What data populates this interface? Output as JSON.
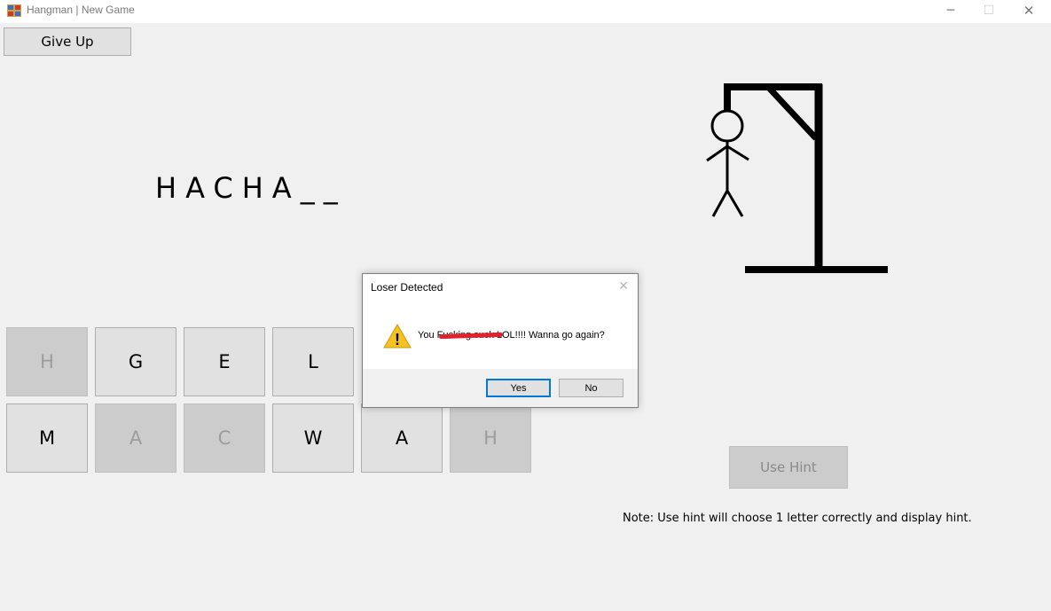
{
  "window": {
    "title": "Hangman | New Game",
    "minimize": "─",
    "maximize": "☐",
    "close": "✕"
  },
  "toolbar": {
    "give_up_label": "Give Up"
  },
  "game": {
    "word_display": "HACHA__",
    "letters_row1": [
      {
        "letter": "H",
        "used": true
      },
      {
        "letter": "G",
        "used": false
      },
      {
        "letter": "E",
        "used": false
      },
      {
        "letter": "L",
        "used": false
      }
    ],
    "letters_row2": [
      {
        "letter": "M",
        "used": false
      },
      {
        "letter": "A",
        "used": true
      },
      {
        "letter": "C",
        "used": true
      },
      {
        "letter": "W",
        "used": false
      },
      {
        "letter": "A",
        "used": false
      },
      {
        "letter": "H",
        "used": true
      }
    ]
  },
  "hint": {
    "button_label": "Use Hint",
    "note": "Note:  Use hint will choose 1 letter correctly and display hint."
  },
  "dialog": {
    "title": "Loser Detected",
    "close": "✕",
    "message_prefix": "You F",
    "message_hidden": "ucking suck",
    "message_suffix": " LOL!!!! Wanna go again?",
    "yes_label": "Yes",
    "no_label": "No",
    "icon": "warning-icon",
    "warning_mark": "!"
  },
  "colors": {
    "accent": "#0078d7",
    "redaction": "#e0222c",
    "warning": "#f5c220"
  }
}
